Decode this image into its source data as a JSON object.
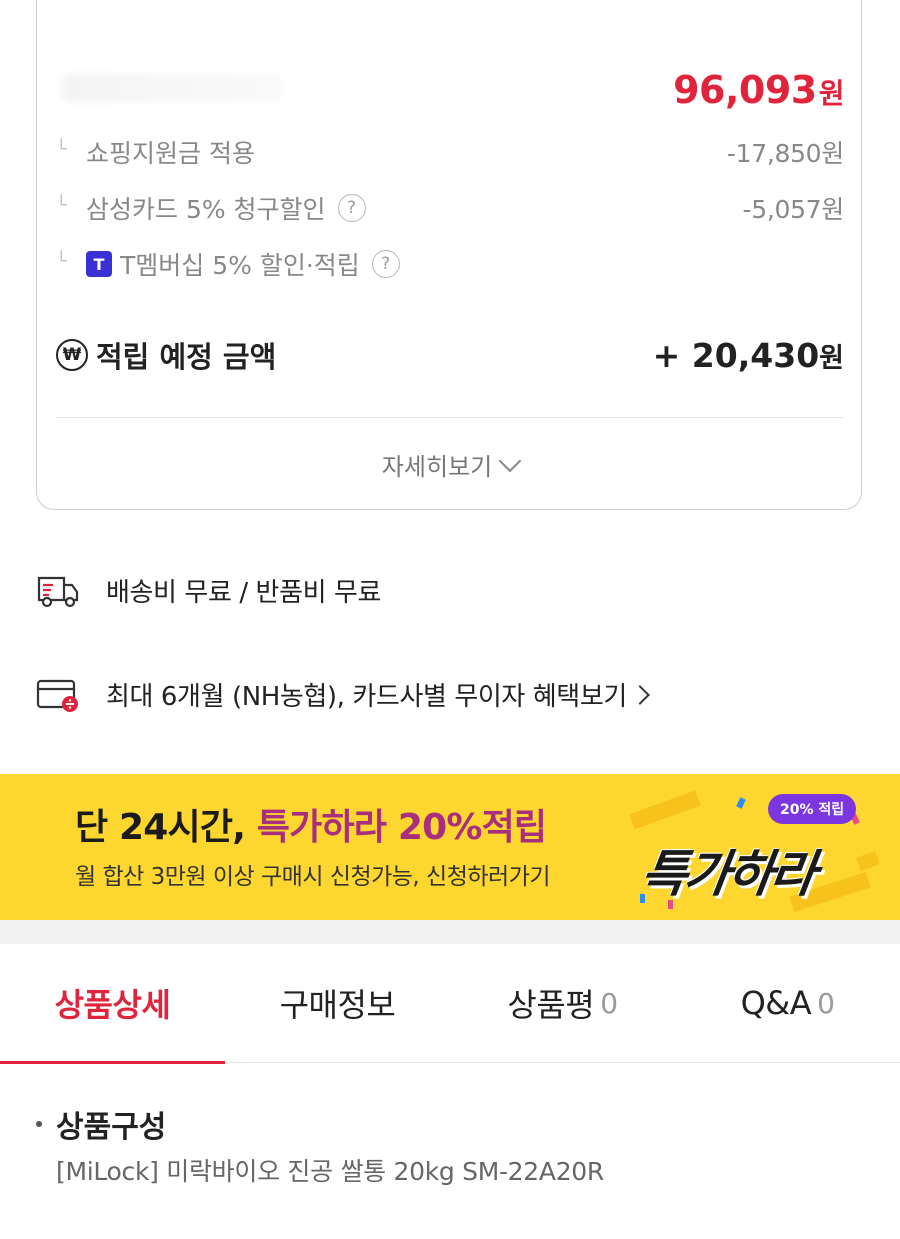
{
  "price_card": {
    "total_price": "96,093",
    "currency": "원",
    "discounts": [
      {
        "label": "쇼핑지원금 적용",
        "amount": "-17,850원"
      },
      {
        "label": "삼성카드 5% 청구할인",
        "amount": "-5,057원"
      },
      {
        "label": "T멤버십 5% 할인·적립",
        "amount": "",
        "badge": "T"
      }
    ],
    "help_glyph": "?",
    "points_icon": "₩",
    "points_label": "적립 예정 금액",
    "points_amount": "+ 20,430",
    "detail_label": "자세히보기"
  },
  "shipping": {
    "text": "배송비 무료 / 반품비 무료"
  },
  "installment": {
    "text": "최대 6개월 (NH농협), 카드사별 무이자 혜택보기"
  },
  "banner": {
    "title_prefix": "단 24시간, ",
    "title_highlight": "특가하라 20%적립",
    "subtitle": "월 합산 3만원 이상 구매시 신청가능, 신청하러가기",
    "pill": "20% 적립",
    "logo": "특가하라",
    "colors": {
      "background": "#fdd630",
      "highlight": "#a92e7e",
      "pill": "#7b36e0"
    }
  },
  "tabs": [
    {
      "label": "상품상세",
      "count": ""
    },
    {
      "label": "구매정보",
      "count": ""
    },
    {
      "label": "상품평",
      "count": "0"
    },
    {
      "label": "Q&A",
      "count": "0"
    }
  ],
  "active_tab": "상품상세",
  "product_section": {
    "title": "상품구성",
    "body": "[MiLock] 미락바이오 진공 쌀통 20kg SM-22A20R"
  },
  "colors": {
    "accent": "#e0243c",
    "t_badge": "#3b2fd6"
  }
}
